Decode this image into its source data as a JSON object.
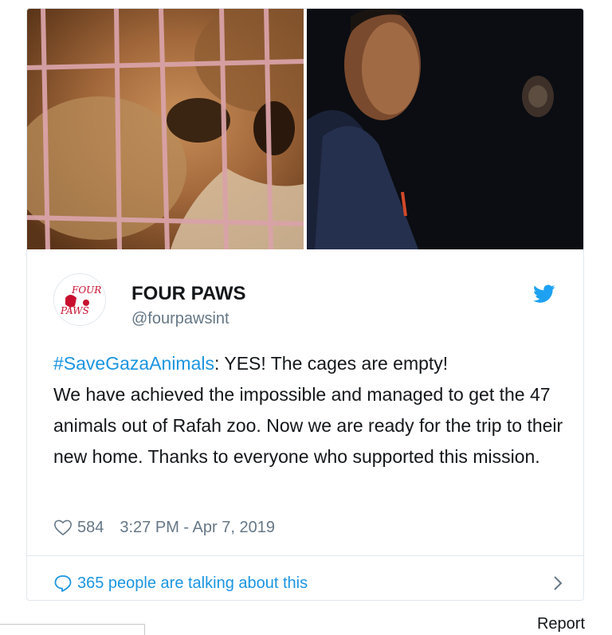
{
  "media": {
    "left_image": "lion behind cage bars",
    "right_image": "smiling man in dark setting"
  },
  "account": {
    "display_name": "FOUR PAWS",
    "handle": "@fourpawsint",
    "avatar_text_top": "FOUR",
    "avatar_text_bottom": "PAWS",
    "platform_icon": "twitter-bird-icon"
  },
  "tweet": {
    "hashtag": "#SaveGazaAnimals",
    "text_line1_rest": ": YES! The cages are empty!",
    "text_body": "We have achieved the impossible and managed to get the 47 animals out of Rafah zoo. Now we are ready for the trip to their new home. Thanks to everyone who supported this mission."
  },
  "meta": {
    "like_icon": "heart-icon",
    "likes": "584",
    "timestamp": "3:27 PM - Apr 7, 2019"
  },
  "conversation": {
    "icon": "speech-bubble-icon",
    "label": "365 people are talking about this",
    "chevron_icon": "chevron-right-icon"
  },
  "footer": {
    "report_label": "Report"
  },
  "colors": {
    "link": "#1b95e0",
    "text": "#14171a",
    "secondary": "#657786",
    "border": "#e1e8ed"
  }
}
